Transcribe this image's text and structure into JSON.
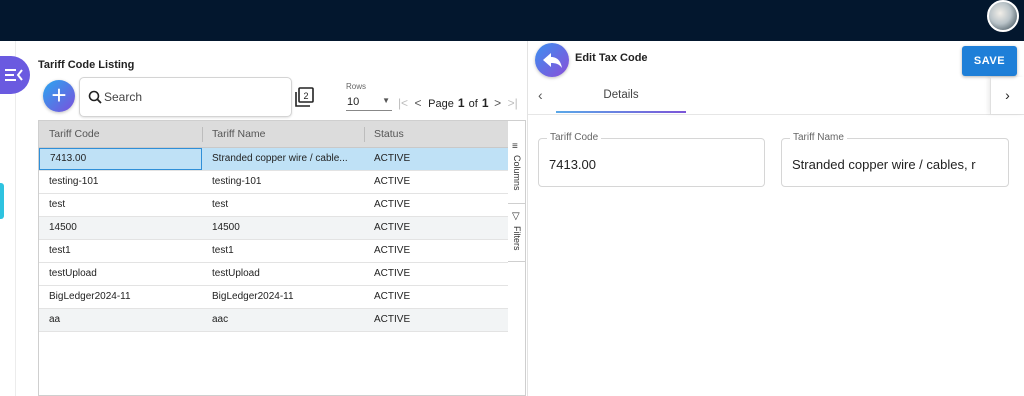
{
  "listing": {
    "title": "Tariff Code Listing",
    "search_placeholder": "Search",
    "rows_label": "Rows",
    "rows_value": "10",
    "page_word": "Page",
    "page_current": "1",
    "of_word": "of",
    "page_total": "1",
    "columns": [
      "Tariff Code",
      "Tariff Name",
      "Status"
    ],
    "rows": [
      {
        "code": "7413.00",
        "name": "Stranded copper wire / cable...",
        "status": "ACTIVE"
      },
      {
        "code": "testing-101",
        "name": "testing-101",
        "status": "ACTIVE"
      },
      {
        "code": "test",
        "name": "test",
        "status": "ACTIVE"
      },
      {
        "code": "14500",
        "name": "14500",
        "status": "ACTIVE"
      },
      {
        "code": "test1",
        "name": "test1",
        "status": "ACTIVE"
      },
      {
        "code": "testUpload",
        "name": "testUpload",
        "status": "ACTIVE"
      },
      {
        "code": "BigLedger2024-11",
        "name": "BigLedger2024-11",
        "status": "ACTIVE"
      },
      {
        "code": "aa",
        "name": "aac",
        "status": "ACTIVE"
      }
    ],
    "side_tabs": {
      "columns": "Columns",
      "filters": "Filters"
    }
  },
  "edit": {
    "title": "Edit Tax Code",
    "save_label": "SAVE",
    "tab_details": "Details",
    "tariff_code_label": "Tariff Code",
    "tariff_code_value": "7413.00",
    "tariff_name_label": "Tariff Name",
    "tariff_name_value": "Stranded copper wire / cables, r"
  },
  "colors": {
    "topbar": "#03172e",
    "accent_blue": "#1e7fd8",
    "accent_purple": "#6a5ae0",
    "row_selected": "#bfe1f6"
  }
}
